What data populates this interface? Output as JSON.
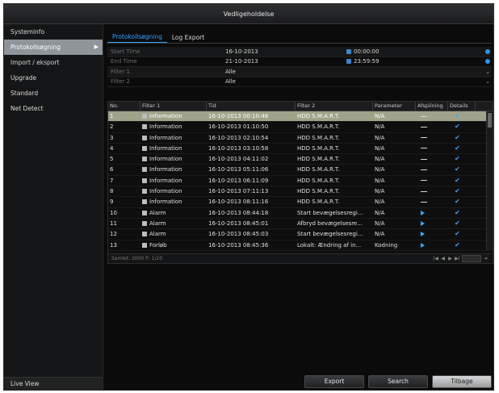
{
  "window": {
    "title": "Vedligeholdelse"
  },
  "sidebar": {
    "items": [
      {
        "label": "Systeminfo"
      },
      {
        "label": "Protokollsøgning"
      },
      {
        "label": "Import / eksport"
      },
      {
        "label": "Upgrade"
      },
      {
        "label": "Standard"
      },
      {
        "label": "Net Detect"
      }
    ],
    "bottom": "Live View"
  },
  "tabs": [
    {
      "label": "Protokollsøgning"
    },
    {
      "label": "Log Export"
    }
  ],
  "filters": {
    "start_time_label": "Start Time",
    "start_date": "16-10-2013",
    "start_time": "00:00:00",
    "end_time_label": "End Time",
    "end_date": "21-10-2013",
    "end_time": "23:59:59",
    "filter1_label": "Filter 1",
    "filter1_value": "Alle",
    "filter2_label": "Filter 2",
    "filter2_value": "Alle"
  },
  "table": {
    "headers": [
      "No.",
      "Filter 1",
      "Tid",
      "Filter 2",
      "Parameter",
      "Afspilning",
      "Details"
    ],
    "rows": [
      {
        "no": "1",
        "f1": "Information",
        "tid": "16-10-2013 00:10:46",
        "f2": "HDD S.M.A.R.T.",
        "par": "N/A",
        "ply": "dash"
      },
      {
        "no": "2",
        "f1": "Information",
        "tid": "16-10-2013 01:10:50",
        "f2": "HDD S.M.A.R.T.",
        "par": "N/A",
        "ply": "dash"
      },
      {
        "no": "3",
        "f1": "Information",
        "tid": "16-10-2013 02:10:54",
        "f2": "HDD S.M.A.R.T.",
        "par": "N/A",
        "ply": "dash"
      },
      {
        "no": "4",
        "f1": "Information",
        "tid": "16-10-2013 03:10:58",
        "f2": "HDD S.M.A.R.T.",
        "par": "N/A",
        "ply": "dash"
      },
      {
        "no": "5",
        "f1": "Information",
        "tid": "16-10-2013 04:11:02",
        "f2": "HDD S.M.A.R.T.",
        "par": "N/A",
        "ply": "dash"
      },
      {
        "no": "6",
        "f1": "Information",
        "tid": "16-10-2013 05:11:06",
        "f2": "HDD S.M.A.R.T.",
        "par": "N/A",
        "ply": "dash"
      },
      {
        "no": "7",
        "f1": "Information",
        "tid": "16-10-2013 06:11:09",
        "f2": "HDD S.M.A.R.T.",
        "par": "N/A",
        "ply": "dash"
      },
      {
        "no": "8",
        "f1": "Information",
        "tid": "16-10-2013 07:11:13",
        "f2": "HDD S.M.A.R.T.",
        "par": "N/A",
        "ply": "dash"
      },
      {
        "no": "9",
        "f1": "Information",
        "tid": "16-10-2013 08:11:16",
        "f2": "HDD S.M.A.R.T.",
        "par": "N/A",
        "ply": "dash"
      },
      {
        "no": "10",
        "f1": "Alarm",
        "tid": "16-10-2013 08:44:18",
        "f2": "Start bevægelsesregi...",
        "par": "N/A",
        "ply": "play"
      },
      {
        "no": "11",
        "f1": "Alarm",
        "tid": "16-10-2013 08:45:01",
        "f2": "Afbryd bevægelsesre...",
        "par": "N/A",
        "ply": "play"
      },
      {
        "no": "12",
        "f1": "Alarm",
        "tid": "16-10-2013 08:45:03",
        "f2": "Start bevægelsesregi...",
        "par": "N/A",
        "ply": "play"
      },
      {
        "no": "13",
        "f1": "Forløb",
        "tid": "16-10-2013 08:45:36",
        "f2": "Lokalt: Ændring af in...",
        "par": "Kodning",
        "ply": "play"
      }
    ],
    "footer": "Samlet: 2000 P: 1/20"
  },
  "buttons": {
    "export": "Export",
    "search": "Search",
    "back": "Tilbage"
  },
  "colors": {
    "accent": "#2fa3ff",
    "selected_row": "#9ea38a",
    "background": "#0b0b0c"
  }
}
